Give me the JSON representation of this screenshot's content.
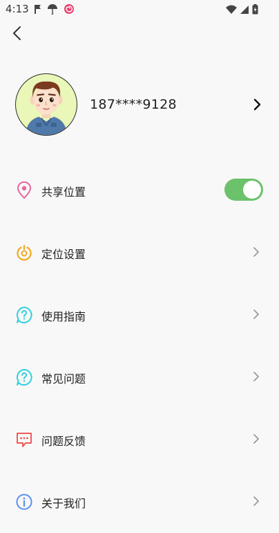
{
  "status_bar": {
    "time": "4:13",
    "left_icons": [
      "notification-flag-icon",
      "umbrella-icon",
      "app-swirl-icon"
    ],
    "right_icons": [
      "wifi-icon",
      "signal-icon",
      "battery-icon"
    ]
  },
  "header": {
    "back_icon": "chevron-left-icon"
  },
  "profile": {
    "phone": "187****9128",
    "avatar_icon": "cartoon-boy-avatar",
    "chevron_icon": "chevron-right-icon"
  },
  "menu": {
    "items": [
      {
        "label": "共享位置",
        "icon": "location-pin-icon",
        "icon_color": "#e8669f",
        "control": "toggle",
        "toggle_on": true
      },
      {
        "label": "定位设置",
        "icon": "power-circle-icon",
        "icon_color": "#f0a920",
        "control": "chevron"
      },
      {
        "label": "使用指南",
        "icon": "help-bubble-icon",
        "icon_color": "#2fcfe0",
        "control": "chevron"
      },
      {
        "label": "常见问题",
        "icon": "help-bubble-icon",
        "icon_color": "#2fcfe0",
        "control": "chevron"
      },
      {
        "label": "问题反馈",
        "icon": "feedback-chat-icon",
        "icon_color": "#ef5a5a",
        "control": "chevron"
      },
      {
        "label": "关于我们",
        "icon": "info-icon",
        "icon_color": "#5a8fef",
        "control": "chevron"
      }
    ]
  },
  "colors": {
    "toggle_on": "#6cc16b",
    "chevron": "#999999",
    "background": "#f8f8f8"
  }
}
